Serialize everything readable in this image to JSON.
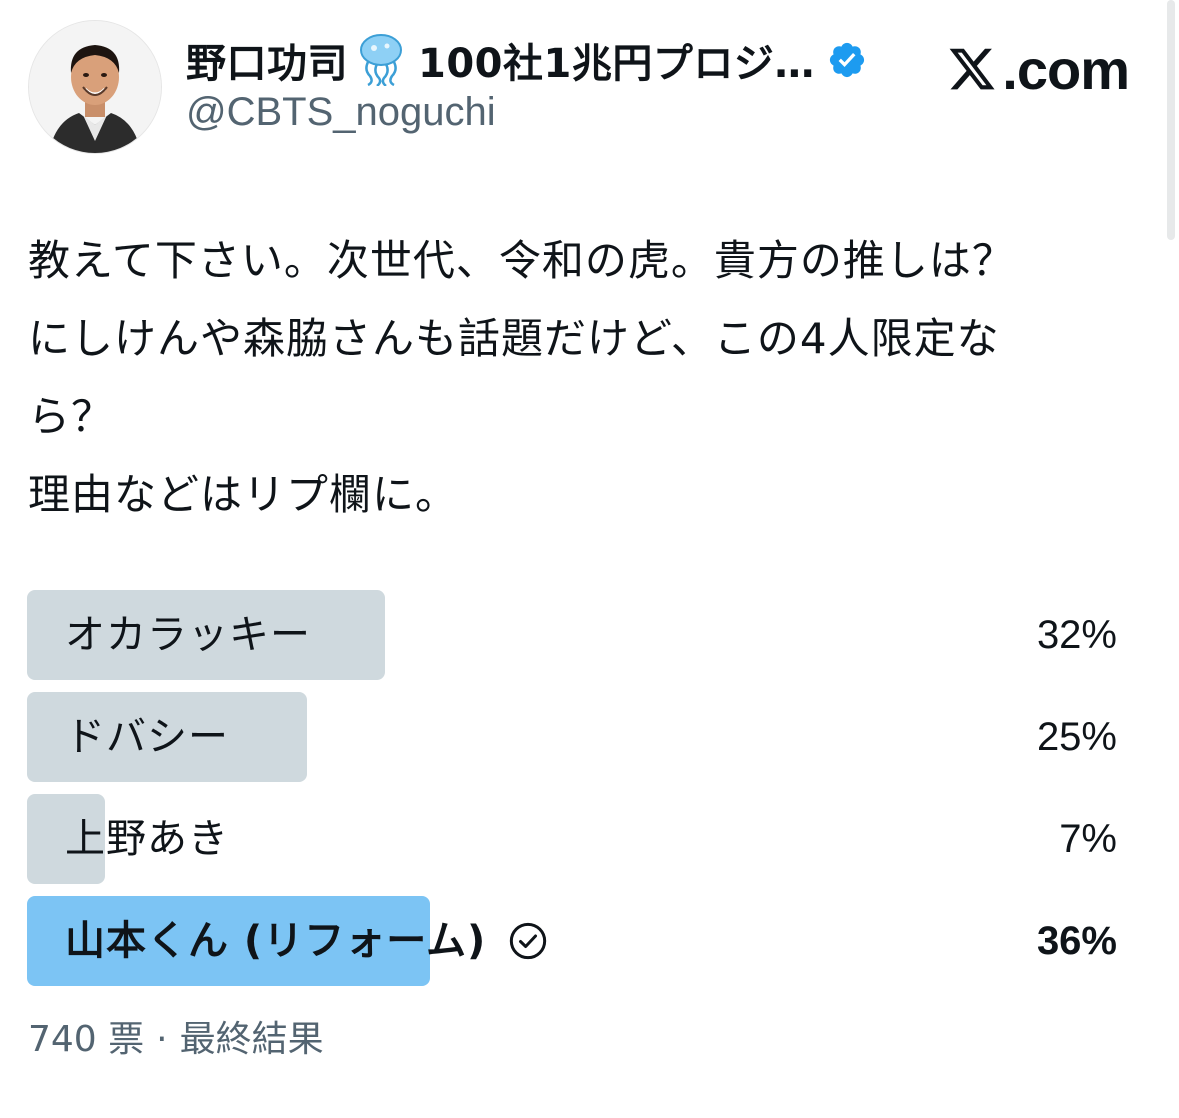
{
  "author": {
    "display_name": "野口功司",
    "name_rest": "100社1兆円プロジ…",
    "handle": "@CBTS_noguchi",
    "verified": true,
    "avatar_icon": "person-portrait-icon",
    "emoji_icon": "jellyfish-icon"
  },
  "brand": {
    "text": ".com",
    "icon": "x-logo-icon"
  },
  "tweet": {
    "lines": [
      "教えて下さい。次世代、令和の虎。貴方の推しは？",
      "にしけんや森脇さんも話題だけど、この4人限定な",
      "ら？",
      "理由などはリプ欄に。"
    ]
  },
  "poll": {
    "options": [
      {
        "label": "オカラッキー",
        "percent_text": "32%",
        "fraction": 0.32,
        "winner": false
      },
      {
        "label": "ドバシー",
        "percent_text": "25%",
        "fraction": 0.25,
        "winner": false
      },
      {
        "label": "上野あき",
        "percent_text": "7%",
        "fraction": 0.07,
        "winner": false
      },
      {
        "label": "山本くん (リフォーム)",
        "percent_text": "36%",
        "fraction": 0.36,
        "winner": true
      }
    ],
    "votes": "740 票",
    "separator": "·",
    "status": "最終結果"
  },
  "colors": {
    "bar": "#cfd9de",
    "winner_bar": "#7cc4f4",
    "verified": "#1d9bf0",
    "secondary_text": "#536471"
  }
}
